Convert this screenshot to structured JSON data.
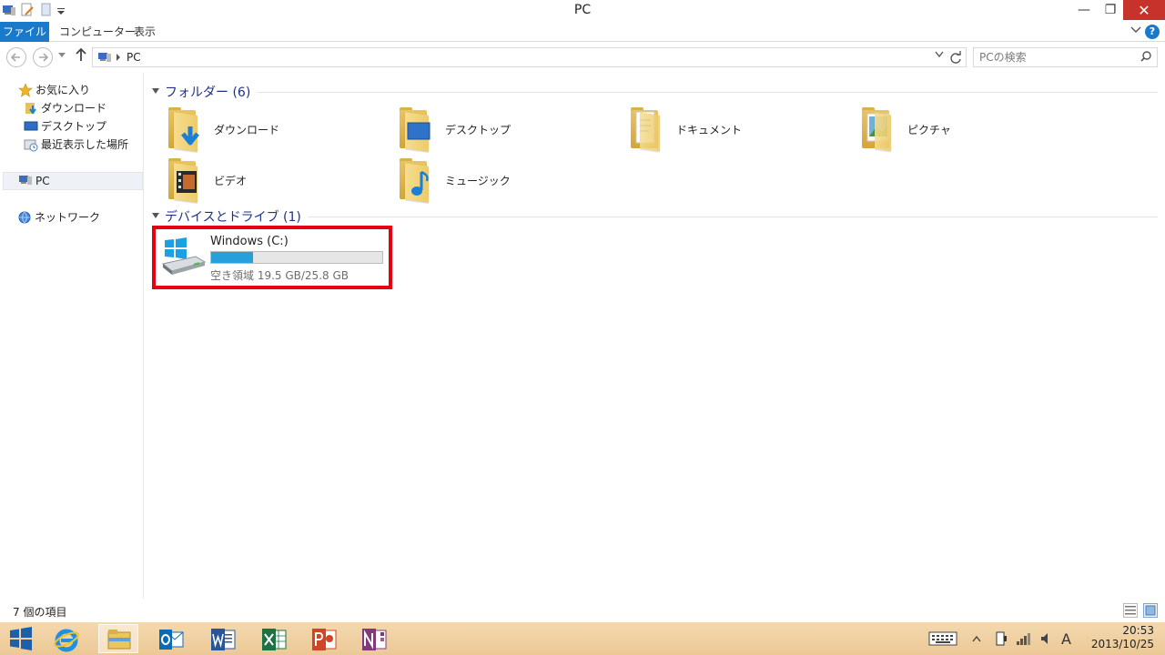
{
  "window": {
    "title": "PC",
    "minimize": "—",
    "maximize": "❐",
    "close": "✕"
  },
  "ribbon": {
    "tabs": [
      "ファイル",
      "コンピューター",
      "表示"
    ]
  },
  "address": {
    "crumb": "PC",
    "search_placeholder": "PCの検索"
  },
  "navpane": {
    "favorites": "お気に入り",
    "favorite_items": [
      "ダウンロード",
      "デスクトップ",
      "最近表示した場所"
    ],
    "pc": "PC",
    "network": "ネットワーク"
  },
  "folders": {
    "header": "フォルダー (6)",
    "items": [
      {
        "label": "ダウンロード",
        "icon": "downloads-folder-icon"
      },
      {
        "label": "デスクトップ",
        "icon": "desktop-folder-icon"
      },
      {
        "label": "ドキュメント",
        "icon": "documents-folder-icon"
      },
      {
        "label": "ピクチャ",
        "icon": "pictures-folder-icon"
      },
      {
        "label": "ビデオ",
        "icon": "videos-folder-icon"
      },
      {
        "label": "ミュージック",
        "icon": "music-folder-icon"
      }
    ]
  },
  "drives": {
    "header": "デバイスとドライブ (1)",
    "items": [
      {
        "name": "Windows (C:)",
        "free_text": "空き領域 19.5 GB/25.8 GB",
        "used_fraction": 0.244
      }
    ]
  },
  "statusbar": {
    "item_count": "7 個の項目"
  },
  "taskbar": {
    "apps": [
      "internet-explorer",
      "file-explorer",
      "outlook",
      "word",
      "excel",
      "powerpoint",
      "onenote"
    ],
    "ime": "A",
    "time": "20:53",
    "date": "2013/10/25"
  },
  "colors": {
    "accent": "#1979ca",
    "highlight_border": "#e60012",
    "drive_fill": "#26a0da",
    "group_header": "#1e3287"
  }
}
